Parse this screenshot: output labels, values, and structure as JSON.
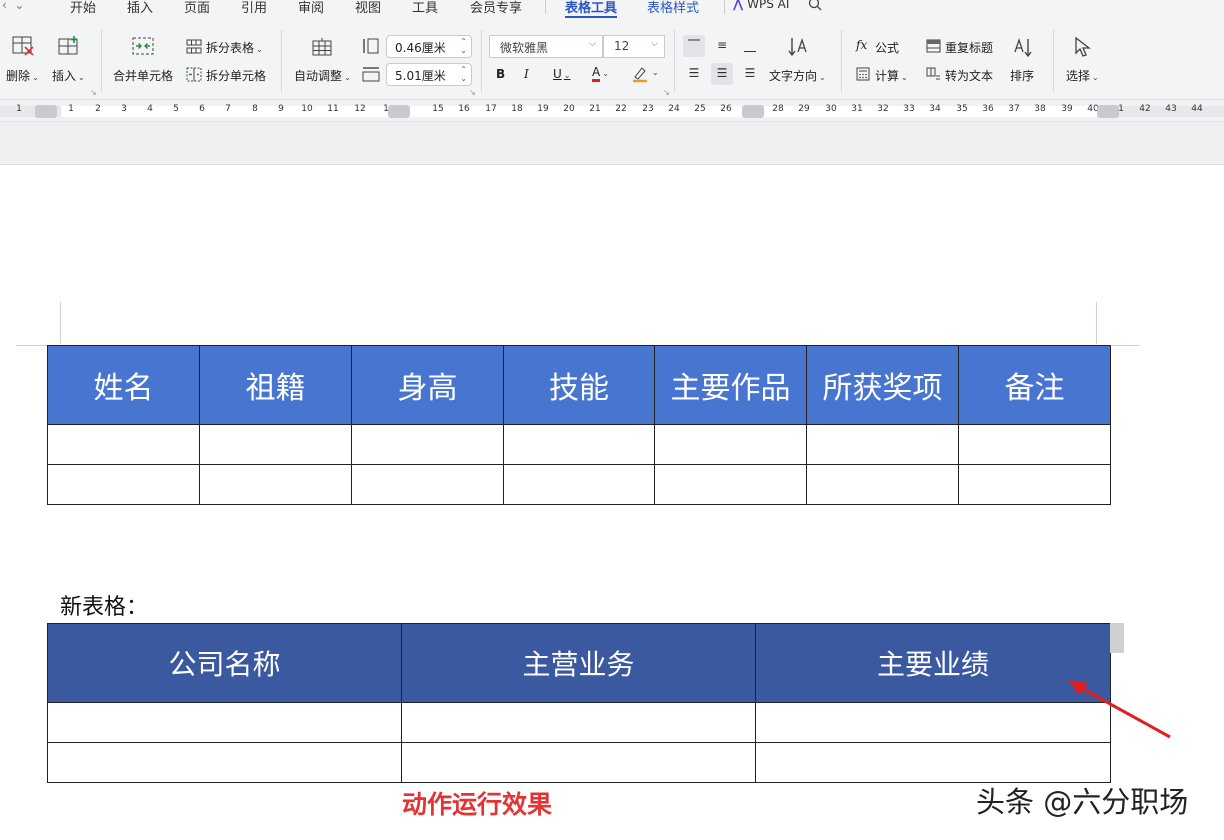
{
  "menubar": {
    "tabs": [
      "开始",
      "插入",
      "页面",
      "引用",
      "审阅",
      "视图",
      "工具",
      "会员专享",
      "表格工具",
      "表格样式"
    ],
    "active_tab": "表格工具",
    "ai_label": "WPS AI"
  },
  "ribbon": {
    "delete_label": "删除",
    "insert_label": "插入",
    "merge_cells_label": "合并单元格",
    "split_table_label": "拆分表格",
    "split_cells_label": "拆分单元格",
    "auto_fit_label": "自动调整",
    "row_height_value": "0.46厘米",
    "col_width_value": "5.01厘米",
    "font_name": "微软雅黑",
    "font_size": "12",
    "bold_label": "B",
    "italic_label": "I",
    "underline_label": "U",
    "font_color_label": "A",
    "text_direction_label": "文字方向",
    "formula_label": "公式",
    "calc_label": "计算",
    "repeat_header_label": "重复标题",
    "to_text_label": "转为文本",
    "sort_label": "排序",
    "select_label": "选择"
  },
  "ruler": {
    "numbers": [
      "1",
      "1",
      "2",
      "3",
      "4",
      "5",
      "6",
      "7",
      "8",
      "9",
      "10",
      "11",
      "12",
      "1",
      "15",
      "16",
      "17",
      "18",
      "19",
      "20",
      "21",
      "22",
      "23",
      "24",
      "25",
      "26",
      "28",
      "29",
      "30",
      "31",
      "32",
      "33",
      "34",
      "35",
      "36",
      "37",
      "38",
      "39",
      "40",
      "1",
      "42",
      "43",
      "44"
    ]
  },
  "table1": {
    "headers": [
      "姓名",
      "祖籍",
      "身高",
      "技能",
      "主要作品",
      "所获奖项",
      "备注"
    ],
    "rows": 2,
    "header_color": "#4875d0"
  },
  "caption": "新表格：",
  "table2": {
    "headers": [
      "公司名称",
      "主营业务",
      "主要业绩"
    ],
    "rows": 2,
    "header_color": "#3a59a0"
  },
  "annotation": {
    "label": "动作运行效果",
    "color": "#e23434"
  },
  "watermark": "头条 @六分职场"
}
